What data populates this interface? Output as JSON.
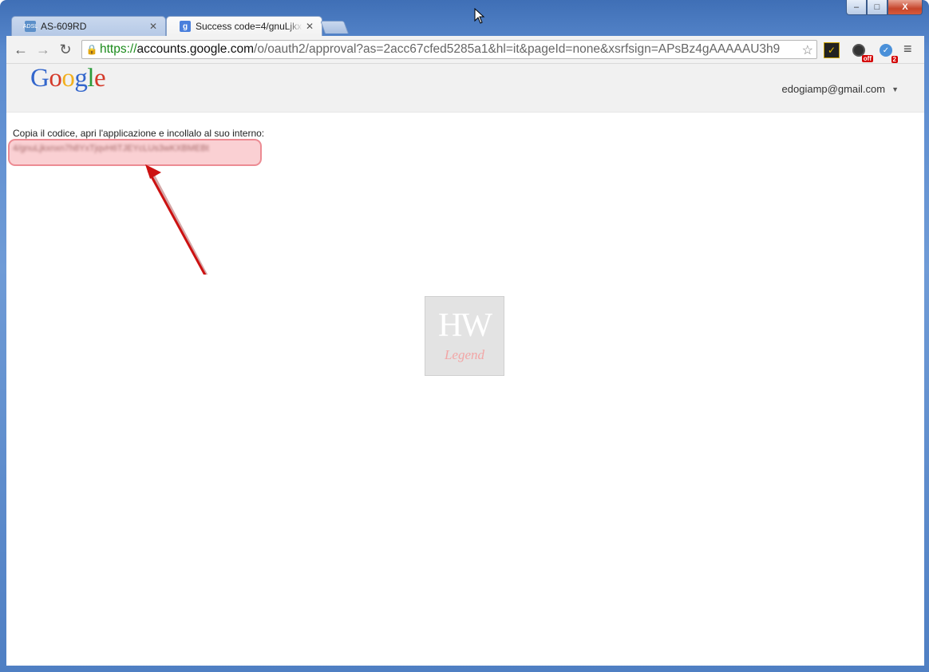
{
  "window": {
    "controls": {
      "minimize": "–",
      "maximize": "□",
      "close": "X"
    }
  },
  "tabs": [
    {
      "title": "AS-609RD",
      "favicon": "router-icon",
      "active": false
    },
    {
      "title": "Success code=4/gnuLjkxn",
      "favicon": "google-icon",
      "active": true
    }
  ],
  "toolbar": {
    "back": "←",
    "forward": "→",
    "reload": "↻",
    "url_scheme": "https://",
    "url_host": "accounts.google.com",
    "url_path": "/o/oauth2/approval?as=2acc67cfed5285a1&hl=it&pageId=none&xsrfsign=APsBz4gAAAAAU3h9",
    "recorder_badge": "off",
    "shield_badge": "2",
    "menu": "≡"
  },
  "page": {
    "logo_letters": [
      "G",
      "o",
      "o",
      "g",
      "l",
      "e"
    ],
    "account_email": "edogiamp@gmail.com",
    "instruction": "Copia il codice, apri l'applicazione e incollalo al suo interno:",
    "code_value": "4/gnuLjkxnxn7h8YxTjqvH6TJEYcLUs3wKXBMEBt",
    "watermark_main": "HW",
    "watermark_sub": "Legend"
  },
  "colors": {
    "highlight": "#f07882",
    "arrow": "#cc1111",
    "url_scheme": "#1a8a1a"
  }
}
